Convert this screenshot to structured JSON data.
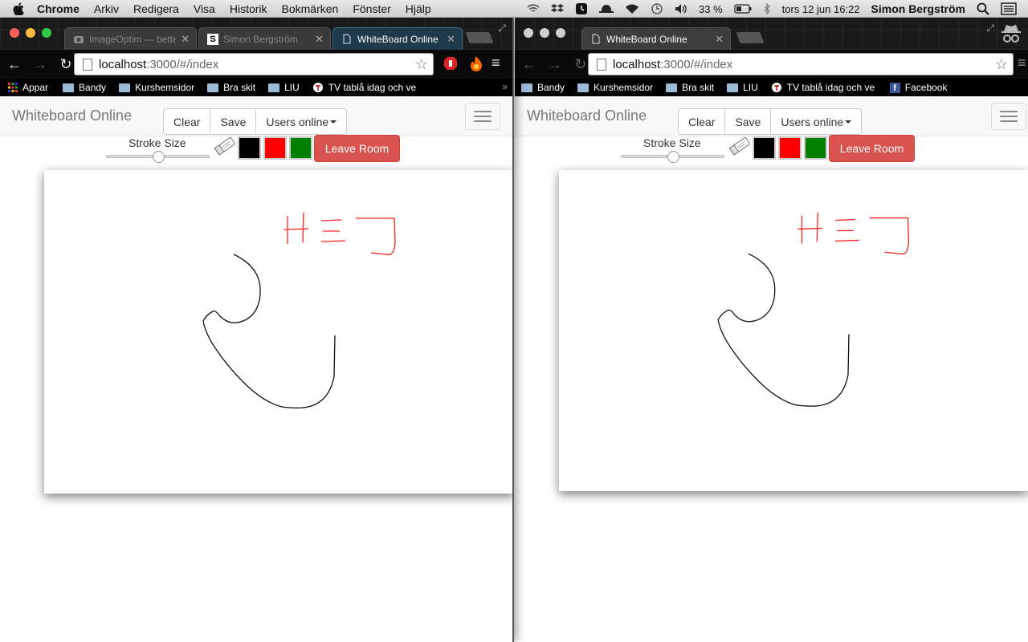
{
  "menubar": {
    "app_name": "Chrome",
    "items": [
      "Arkiv",
      "Redigera",
      "Visa",
      "Historik",
      "Bokmärken",
      "Fönster",
      "Hjälp"
    ],
    "battery": "33 %",
    "datetime": "tors 12 jun  16:22",
    "user": "Simon Bergström"
  },
  "left_window": {
    "tabs": [
      {
        "title": "ImageOptim — bette",
        "favicon": "imageoptim-icon"
      },
      {
        "title": "Simon Bergström",
        "favicon": "s-icon"
      },
      {
        "title": "WhiteBoard Online",
        "favicon": "page-icon"
      }
    ],
    "url_host": "localhost",
    "url_path": ":3000/#/index",
    "bookmarks": [
      "Appar",
      "Bandy",
      "Kurshemsidor",
      "Bra skit",
      "LIU",
      "TV tablå idag och ve"
    ],
    "bookmark_more": "»"
  },
  "right_window": {
    "tabs": [
      {
        "title": "WhiteBoard Online",
        "favicon": "page-icon"
      }
    ],
    "url_host": "localhost",
    "url_path": ":3000/#/index",
    "bookmarks": [
      "Bandy",
      "Kurshemsidor",
      "Bra skit",
      "LIU",
      "TV tablå idag och ve",
      "Facebook"
    ]
  },
  "app": {
    "brand": "Whiteboard Online",
    "buttons": {
      "clear": "Clear",
      "save": "Save",
      "users_online": "Users online"
    },
    "stroke_label": "Stroke Size",
    "stroke_value": 0.5,
    "colors": [
      "#000000",
      "#ff0000",
      "#008000"
    ],
    "leave_room": "Leave Room"
  }
}
